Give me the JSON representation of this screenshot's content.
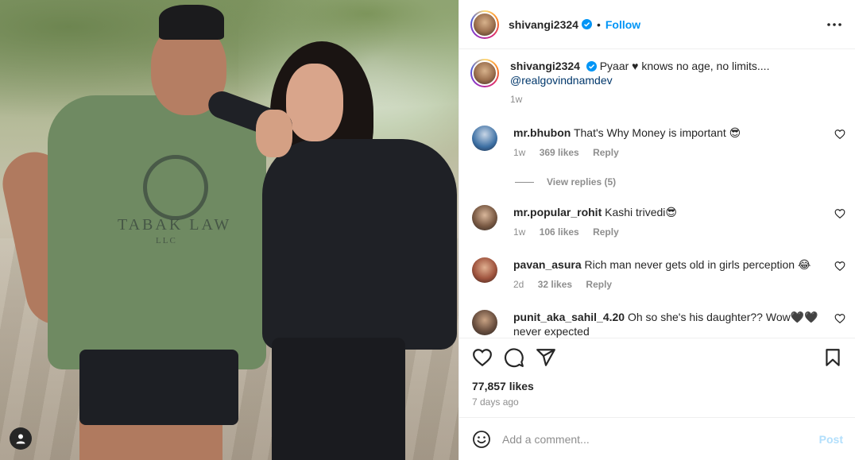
{
  "post": {
    "author": "shivangi2324",
    "follow_label": "Follow",
    "separator": "•",
    "caption_text": "Pyaar ♥ knows no age, no limits....",
    "caption_mention": "@realgovindnamdev",
    "caption_time": "1w",
    "photo_shirt_text": "TABAK LAW",
    "photo_shirt_sub": "LLC"
  },
  "comments": [
    {
      "user": "mr.bhubon",
      "text": "That's Why Money is important 😎",
      "time": "1w",
      "likes": "369 likes",
      "reply": "Reply"
    },
    {
      "user": "mr.popular_rohit",
      "text": "Kashi trivedi😎",
      "time": "1w",
      "likes": "106 likes",
      "reply": "Reply"
    },
    {
      "user": "pavan_asura",
      "text": "Rich man never gets old in girls perception 😂",
      "time": "2d",
      "likes": "32 likes",
      "reply": "Reply"
    },
    {
      "user": "punit_aka_sahil_4.20",
      "text": "Oh so she's his daughter?? Wow🖤🖤 never expected",
      "time": "",
      "likes": "",
      "reply": ""
    }
  ],
  "view_replies": "View replies (5)",
  "likes_total": "77,857 likes",
  "posted_ago": "7 days ago",
  "add_comment": {
    "placeholder": "Add a comment...",
    "post_label": "Post"
  },
  "icons": {
    "more": "more-options-icon",
    "like": "heart-icon",
    "comment": "comment-icon",
    "share": "share-icon",
    "save": "bookmark-icon",
    "emoji": "emoji-icon",
    "tag": "user-tag-icon",
    "verified": "verified-badge-icon"
  },
  "colors": {
    "accent": "#0095f6",
    "text": "#262626",
    "muted": "#8e8e8e",
    "post_disabled": "#b2dffc"
  }
}
